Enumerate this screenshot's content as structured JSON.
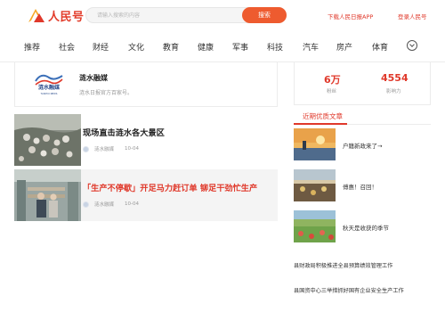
{
  "header": {
    "logo_text": "人民号",
    "search_placeholder": "请输入搜索的内容",
    "search_button": "搜索",
    "download_link": "下载人民日报APP",
    "login_link": "登录人民号"
  },
  "nav": {
    "items": [
      "推荐",
      "社会",
      "财经",
      "文化",
      "教育",
      "健康",
      "军事",
      "科技",
      "汽车",
      "房产",
      "体育"
    ],
    "more_icon": "chevron-down-circle-icon"
  },
  "profile": {
    "logo_caption": "TAISHUI NEWS",
    "name": "涟水融媒",
    "description": "涟水日报官方百家号。"
  },
  "articles": [
    {
      "title": "现场直击涟水各大景区",
      "source": "涟水融媒",
      "date": "10-04",
      "highlighted": false
    },
    {
      "title": "「生产不停歇」开足马力赶订单 铆足干劲忙生产",
      "source": "涟水融媒",
      "date": "10-04",
      "highlighted": true
    }
  ],
  "stats": {
    "fans_value": "6万",
    "fans_label": "粉丝",
    "influence_value": "4554",
    "influence_label": "影响力"
  },
  "recent": {
    "title": "近期优质文章",
    "items": [
      {
        "text": "户籍新政来了→"
      },
      {
        "text": "傅惠！召回！"
      },
      {
        "text": "秋天是收获的季节"
      }
    ],
    "news": [
      "县财政局积极推进全县预算绩效管理工作",
      "县国资中心三举措抓好国有企业安全生产工作"
    ]
  },
  "colors": {
    "brand_red": "#e0392b",
    "search_orange": "#ee5b2f"
  }
}
